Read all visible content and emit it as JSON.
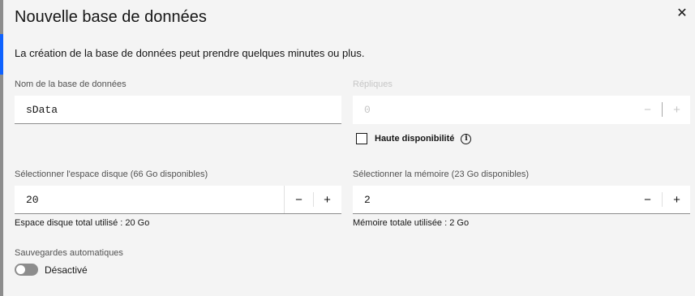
{
  "modal": {
    "title": "Nouvelle base de données",
    "close_icon": "close-icon",
    "close_glyph": "✕",
    "intro": "La création de la base de données peut prendre quelques minutes ou plus."
  },
  "db_name": {
    "label": "Nom de la base de données",
    "value": "sData"
  },
  "replicas": {
    "label": "Répliques",
    "value": "0",
    "decrement": "−",
    "increment": "+",
    "disabled": true
  },
  "high_availability": {
    "label": "Haute disponibilité",
    "checked": false,
    "info_icon": "info-icon",
    "info_glyph": "i"
  },
  "disk": {
    "label": "Sélectionner l'espace disque (66 Go disponibles)",
    "value": "20",
    "decrement": "−",
    "increment": "+",
    "helper": "Espace disque total utilisé : 20 Go"
  },
  "memory": {
    "label": "Sélectionner la mémoire (23 Go disponibles)",
    "value": "2",
    "decrement": "−",
    "increment": "+",
    "helper": "Mémoire totale utilisée : 2 Go"
  },
  "backups": {
    "label": "Sauvegardes automatiques",
    "toggle_label": "Désactivé",
    "enabled": false
  },
  "colors": {
    "accent": "#0f62fe",
    "field_bg": "#ffffff",
    "modal_bg": "#f4f4f4"
  }
}
